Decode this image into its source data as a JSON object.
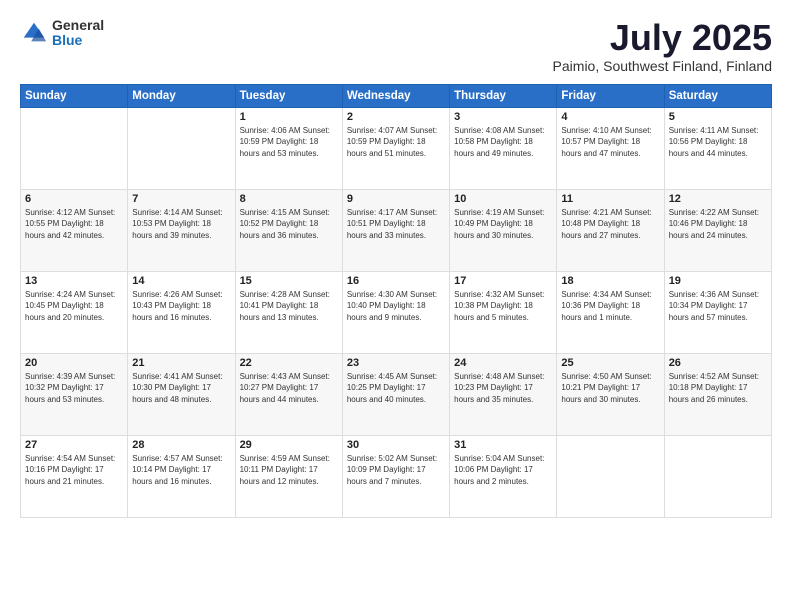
{
  "header": {
    "logo_general": "General",
    "logo_blue": "Blue",
    "title": "July 2025",
    "location": "Paimio, Southwest Finland, Finland"
  },
  "weekdays": [
    "Sunday",
    "Monday",
    "Tuesday",
    "Wednesday",
    "Thursday",
    "Friday",
    "Saturday"
  ],
  "weeks": [
    [
      {
        "day": "",
        "info": ""
      },
      {
        "day": "",
        "info": ""
      },
      {
        "day": "1",
        "info": "Sunrise: 4:06 AM\nSunset: 10:59 PM\nDaylight: 18 hours\nand 53 minutes."
      },
      {
        "day": "2",
        "info": "Sunrise: 4:07 AM\nSunset: 10:59 PM\nDaylight: 18 hours\nand 51 minutes."
      },
      {
        "day": "3",
        "info": "Sunrise: 4:08 AM\nSunset: 10:58 PM\nDaylight: 18 hours\nand 49 minutes."
      },
      {
        "day": "4",
        "info": "Sunrise: 4:10 AM\nSunset: 10:57 PM\nDaylight: 18 hours\nand 47 minutes."
      },
      {
        "day": "5",
        "info": "Sunrise: 4:11 AM\nSunset: 10:56 PM\nDaylight: 18 hours\nand 44 minutes."
      }
    ],
    [
      {
        "day": "6",
        "info": "Sunrise: 4:12 AM\nSunset: 10:55 PM\nDaylight: 18 hours\nand 42 minutes."
      },
      {
        "day": "7",
        "info": "Sunrise: 4:14 AM\nSunset: 10:53 PM\nDaylight: 18 hours\nand 39 minutes."
      },
      {
        "day": "8",
        "info": "Sunrise: 4:15 AM\nSunset: 10:52 PM\nDaylight: 18 hours\nand 36 minutes."
      },
      {
        "day": "9",
        "info": "Sunrise: 4:17 AM\nSunset: 10:51 PM\nDaylight: 18 hours\nand 33 minutes."
      },
      {
        "day": "10",
        "info": "Sunrise: 4:19 AM\nSunset: 10:49 PM\nDaylight: 18 hours\nand 30 minutes."
      },
      {
        "day": "11",
        "info": "Sunrise: 4:21 AM\nSunset: 10:48 PM\nDaylight: 18 hours\nand 27 minutes."
      },
      {
        "day": "12",
        "info": "Sunrise: 4:22 AM\nSunset: 10:46 PM\nDaylight: 18 hours\nand 24 minutes."
      }
    ],
    [
      {
        "day": "13",
        "info": "Sunrise: 4:24 AM\nSunset: 10:45 PM\nDaylight: 18 hours\nand 20 minutes."
      },
      {
        "day": "14",
        "info": "Sunrise: 4:26 AM\nSunset: 10:43 PM\nDaylight: 18 hours\nand 16 minutes."
      },
      {
        "day": "15",
        "info": "Sunrise: 4:28 AM\nSunset: 10:41 PM\nDaylight: 18 hours\nand 13 minutes."
      },
      {
        "day": "16",
        "info": "Sunrise: 4:30 AM\nSunset: 10:40 PM\nDaylight: 18 hours\nand 9 minutes."
      },
      {
        "day": "17",
        "info": "Sunrise: 4:32 AM\nSunset: 10:38 PM\nDaylight: 18 hours\nand 5 minutes."
      },
      {
        "day": "18",
        "info": "Sunrise: 4:34 AM\nSunset: 10:36 PM\nDaylight: 18 hours\nand 1 minute."
      },
      {
        "day": "19",
        "info": "Sunrise: 4:36 AM\nSunset: 10:34 PM\nDaylight: 17 hours\nand 57 minutes."
      }
    ],
    [
      {
        "day": "20",
        "info": "Sunrise: 4:39 AM\nSunset: 10:32 PM\nDaylight: 17 hours\nand 53 minutes."
      },
      {
        "day": "21",
        "info": "Sunrise: 4:41 AM\nSunset: 10:30 PM\nDaylight: 17 hours\nand 48 minutes."
      },
      {
        "day": "22",
        "info": "Sunrise: 4:43 AM\nSunset: 10:27 PM\nDaylight: 17 hours\nand 44 minutes."
      },
      {
        "day": "23",
        "info": "Sunrise: 4:45 AM\nSunset: 10:25 PM\nDaylight: 17 hours\nand 40 minutes."
      },
      {
        "day": "24",
        "info": "Sunrise: 4:48 AM\nSunset: 10:23 PM\nDaylight: 17 hours\nand 35 minutes."
      },
      {
        "day": "25",
        "info": "Sunrise: 4:50 AM\nSunset: 10:21 PM\nDaylight: 17 hours\nand 30 minutes."
      },
      {
        "day": "26",
        "info": "Sunrise: 4:52 AM\nSunset: 10:18 PM\nDaylight: 17 hours\nand 26 minutes."
      }
    ],
    [
      {
        "day": "27",
        "info": "Sunrise: 4:54 AM\nSunset: 10:16 PM\nDaylight: 17 hours\nand 21 minutes."
      },
      {
        "day": "28",
        "info": "Sunrise: 4:57 AM\nSunset: 10:14 PM\nDaylight: 17 hours\nand 16 minutes."
      },
      {
        "day": "29",
        "info": "Sunrise: 4:59 AM\nSunset: 10:11 PM\nDaylight: 17 hours\nand 12 minutes."
      },
      {
        "day": "30",
        "info": "Sunrise: 5:02 AM\nSunset: 10:09 PM\nDaylight: 17 hours\nand 7 minutes."
      },
      {
        "day": "31",
        "info": "Sunrise: 5:04 AM\nSunset: 10:06 PM\nDaylight: 17 hours\nand 2 minutes."
      },
      {
        "day": "",
        "info": ""
      },
      {
        "day": "",
        "info": ""
      }
    ]
  ]
}
